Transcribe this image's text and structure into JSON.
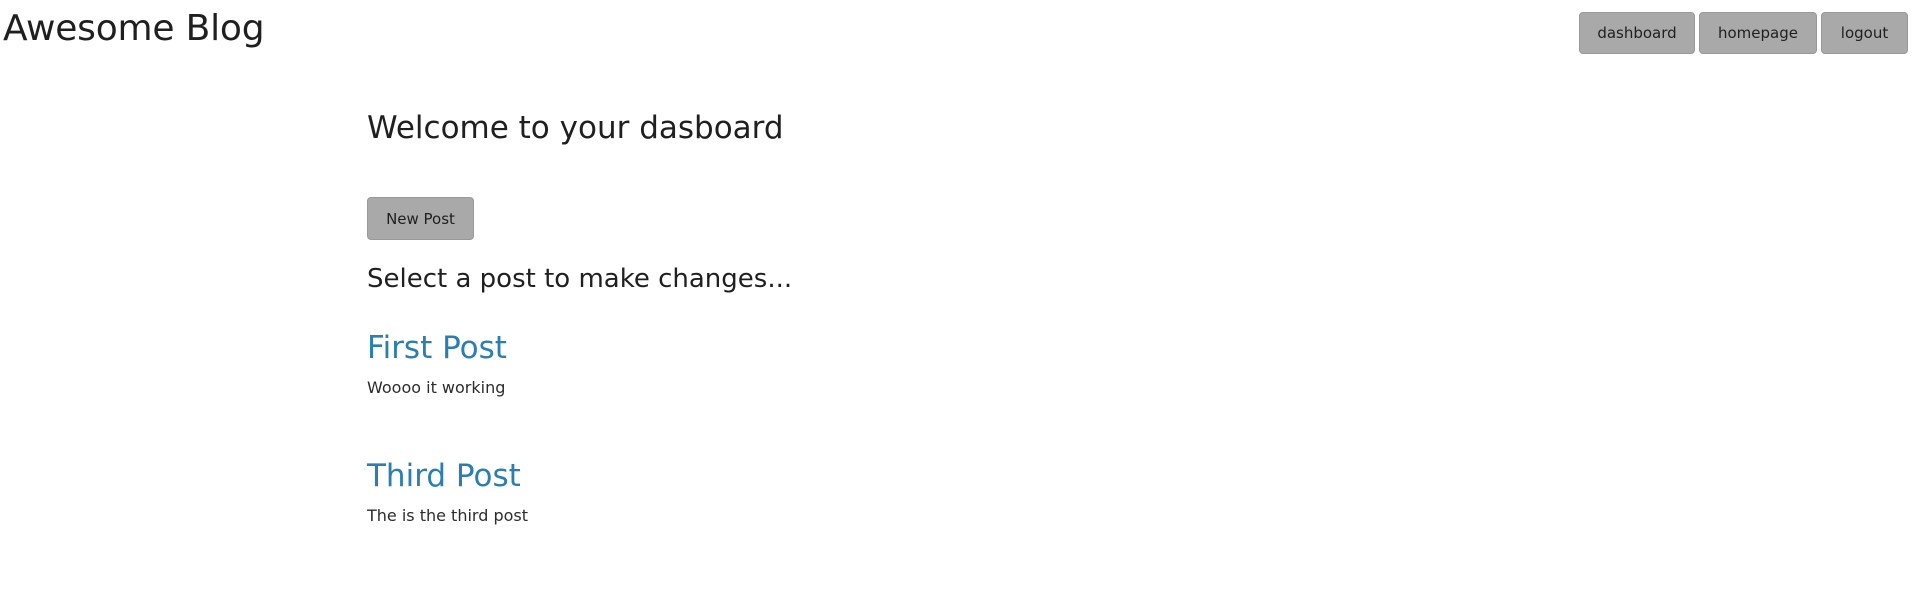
{
  "header": {
    "brand": "Awesome Blog",
    "nav": {
      "dashboard": "dashboard",
      "homepage": "homepage",
      "logout": "logout"
    }
  },
  "main": {
    "title": "Welcome to your dasboard",
    "new_post_label": "New Post",
    "section_title": "Select a post to make changes...",
    "posts": [
      {
        "title": "First Post",
        "body": "Woooo it working"
      },
      {
        "title": "Third Post",
        "body": "The is the third post"
      }
    ]
  },
  "colors": {
    "button_bg": "#a9a9a9",
    "link": "#2a7fb0",
    "text": "#1f1f1f"
  }
}
